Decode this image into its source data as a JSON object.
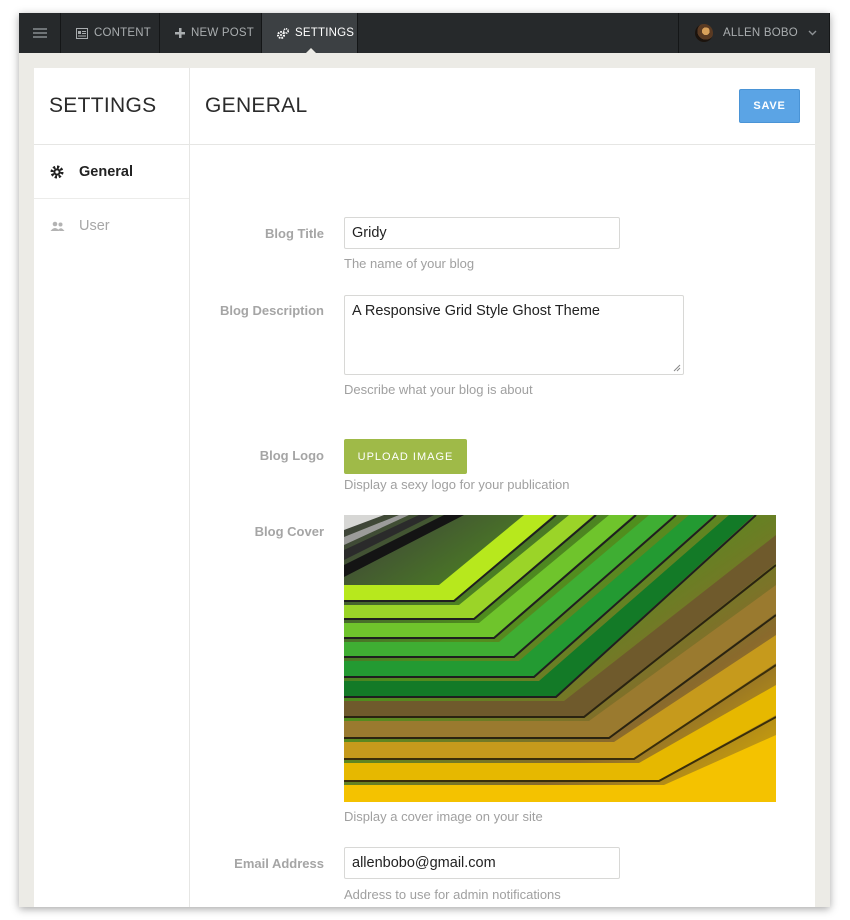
{
  "topnav": {
    "content_label": "CONTENT",
    "new_post_label": "NEW POST",
    "settings_label": "SETTINGS",
    "user_name": "ALLEN BOBO",
    "bg_color": "#26292b"
  },
  "sidebar": {
    "title": "SETTINGS",
    "items": [
      {
        "label": "General",
        "icon": "gear-icon",
        "active": true
      },
      {
        "label": "User",
        "icon": "users-icon",
        "active": false
      }
    ]
  },
  "main": {
    "title": "GENERAL",
    "save_label": "SAVE",
    "accent_color": "#5ba4e5"
  },
  "form": {
    "blog_title": {
      "label": "Blog Title",
      "value": "Gridy",
      "help": "The name of your blog"
    },
    "blog_description": {
      "label": "Blog Description",
      "value": "A Responsive Grid Style Ghost Theme",
      "help": "Describe what your blog is about"
    },
    "blog_logo": {
      "label": "Blog Logo",
      "button_label": "UPLOAD IMAGE",
      "help": "Display a sexy logo for your publication",
      "button_color": "#9fba48"
    },
    "blog_cover": {
      "label": "Blog Cover",
      "help": "Display a cover image on your site"
    },
    "email": {
      "label": "Email Address",
      "value": "allenbobo@gmail.com",
      "help": "Address to use for admin notifications"
    }
  }
}
